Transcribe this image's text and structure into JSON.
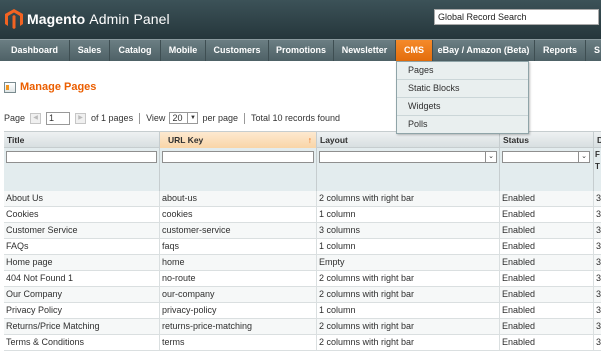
{
  "header": {
    "logo_brand": "Magento",
    "logo_suffix": "Admin Panel",
    "global_search_placeholder": "Global Record Search"
  },
  "nav": {
    "items": [
      {
        "label": "Dashboard"
      },
      {
        "label": "Sales"
      },
      {
        "label": "Catalog"
      },
      {
        "label": "Mobile"
      },
      {
        "label": "Customers"
      },
      {
        "label": "Promotions"
      },
      {
        "label": "Newsletter"
      },
      {
        "label": "CMS",
        "active": true
      },
      {
        "label": "eBay / Amazon (Beta)"
      },
      {
        "label": "Reports"
      },
      {
        "label": "S"
      }
    ],
    "active_color": "#eb6d0f"
  },
  "cms_menu": {
    "items": [
      "Pages",
      "Static Blocks",
      "Widgets",
      "Polls"
    ]
  },
  "page": {
    "icon": "pages-icon",
    "title": "Manage Pages"
  },
  "pager": {
    "page_label": "Page",
    "page_value": "1",
    "of_pages": "of 1 pages",
    "view_label": "View",
    "per_page_value": "20",
    "per_page_label": "per page",
    "total_records": "Total 10 records found"
  },
  "grid": {
    "columns": [
      {
        "label": "Title"
      },
      {
        "label": "URL Key",
        "sorted": true
      },
      {
        "label": "Layout"
      },
      {
        "label": "Status"
      },
      {
        "label": "D"
      }
    ],
    "sort_arrow": "↑",
    "filter_extra": [
      "F",
      "T"
    ],
    "rows": [
      {
        "title": "About Us",
        "url_key": "about-us",
        "layout": "2 columns with right bar",
        "status": "Enabled",
        "extra": "3"
      },
      {
        "title": "Cookies",
        "url_key": "cookies",
        "layout": "1 column",
        "status": "Enabled",
        "extra": "3"
      },
      {
        "title": "Customer Service",
        "url_key": "customer-service",
        "layout": "3 columns",
        "status": "Enabled",
        "extra": "3"
      },
      {
        "title": "FAQs",
        "url_key": "faqs",
        "layout": "1 column",
        "status": "Enabled",
        "extra": "3"
      },
      {
        "title": "Home page",
        "url_key": "home",
        "layout": "Empty",
        "status": "Enabled",
        "extra": "3"
      },
      {
        "title": "404 Not Found 1",
        "url_key": "no-route",
        "layout": "2 columns with right bar",
        "status": "Enabled",
        "extra": "3"
      },
      {
        "title": "Our Company",
        "url_key": "our-company",
        "layout": "2 columns with right bar",
        "status": "Enabled",
        "extra": "3"
      },
      {
        "title": "Privacy Policy",
        "url_key": "privacy-policy",
        "layout": "1 column",
        "status": "Enabled",
        "extra": "3"
      },
      {
        "title": "Returns/Price Matching",
        "url_key": "returns-price-matching",
        "layout": "2 columns with right bar",
        "status": "Enabled",
        "extra": "3"
      },
      {
        "title": "Terms & Conditions",
        "url_key": "terms",
        "layout": "2 columns with right bar",
        "status": "Enabled",
        "extra": "3"
      }
    ]
  }
}
